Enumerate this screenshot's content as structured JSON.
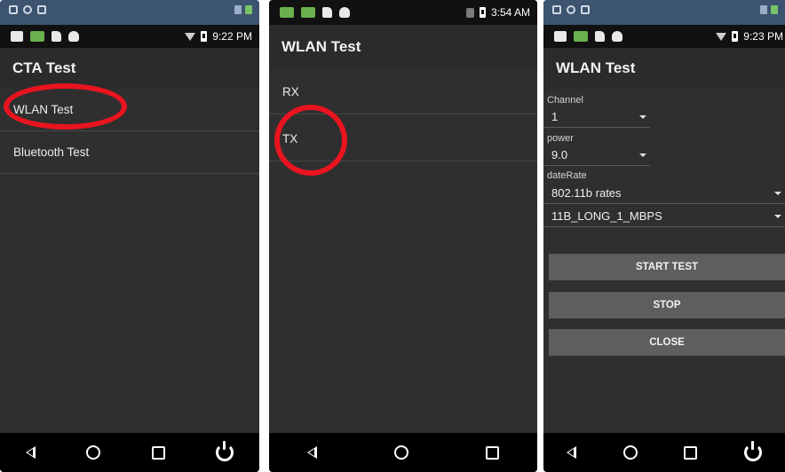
{
  "panel1": {
    "status": {
      "time": "9:22 PM"
    },
    "title": "CTA Test",
    "items": [
      {
        "label": "WLAN Test"
      },
      {
        "label": "Bluetooth Test"
      }
    ]
  },
  "panel2": {
    "status": {
      "time": "3:54 AM"
    },
    "title": "WLAN Test",
    "items": [
      {
        "label": "RX"
      },
      {
        "label": "TX"
      }
    ]
  },
  "panel3": {
    "status": {
      "time": "9:23 PM"
    },
    "title": "WLAN Test",
    "channel": {
      "label": "Channel",
      "value": "1"
    },
    "power": {
      "label": "power",
      "value": "9.0"
    },
    "datarate": {
      "label": "dateRate",
      "value": "802.11b rates",
      "rate": "11B_LONG_1_MBPS"
    },
    "buttons": {
      "start": "START TEST",
      "stop": "STOP",
      "close": "CLOSE"
    }
  },
  "colors": {
    "highlight": "#e8141f",
    "statusbar_top": "#3c5470",
    "app_bg": "#2f2f2f"
  }
}
